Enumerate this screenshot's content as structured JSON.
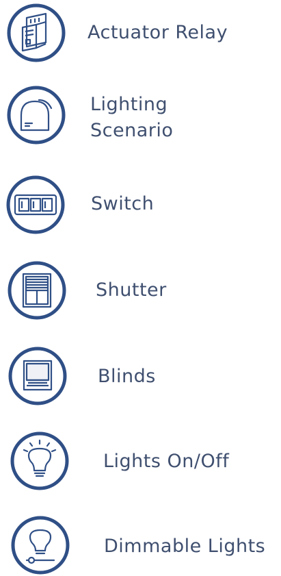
{
  "colors": {
    "ring": "#2f4f86",
    "glyph": "#2f4f86",
    "label": "#3f4f6f",
    "background": "#ffffff"
  },
  "devices": [
    {
      "label": "Actuator Relay",
      "icon": "relay-icon"
    },
    {
      "label_line1": "Lighting",
      "label_line2": "Scenario",
      "icon": "lighting-scenario-icon"
    },
    {
      "label": "Switch",
      "icon": "switch-icon"
    },
    {
      "label": "Shutter",
      "icon": "shutter-icon"
    },
    {
      "label": "Blinds",
      "icon": "blinds-icon"
    },
    {
      "label": "Lights On/Off",
      "icon": "lightbulb-rays-icon"
    },
    {
      "label": "Dimmable Lights",
      "icon": "dimmable-lightbulb-icon"
    }
  ]
}
